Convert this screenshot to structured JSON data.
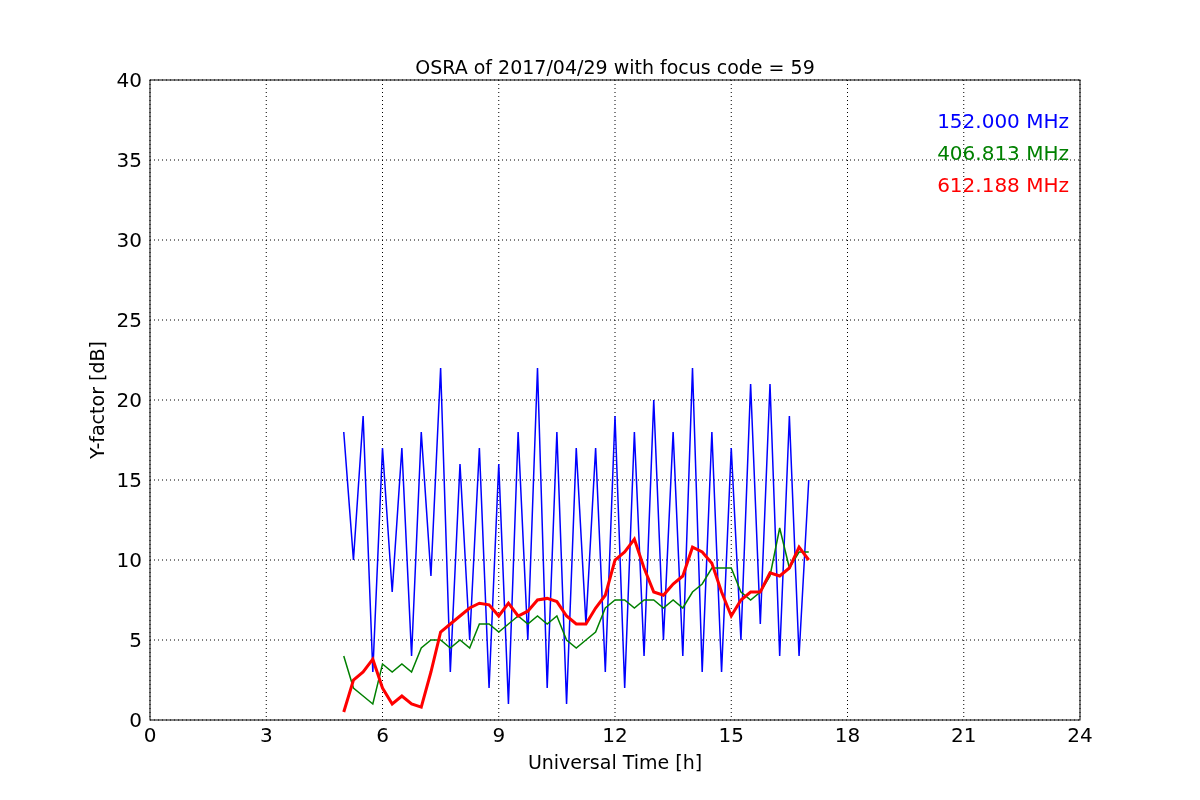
{
  "figure": {
    "chart_data": {
      "type": "line",
      "title": "OSRA of 2017/04/29 with focus code = 59",
      "xlabel": "Universal Time [h]",
      "ylabel": "Y-factor [dB]",
      "x": [
        5,
        5.25,
        5.5,
        5.75,
        6,
        6.25,
        6.5,
        6.75,
        7,
        7.25,
        7.5,
        7.75,
        8,
        8.25,
        8.5,
        8.75,
        9,
        9.25,
        9.5,
        9.75,
        10,
        10.25,
        10.5,
        10.75,
        11,
        11.25,
        11.5,
        11.75,
        12,
        12.25,
        12.5,
        12.75,
        13,
        13.25,
        13.5,
        13.75,
        14,
        14.25,
        14.5,
        14.75,
        15,
        15.25,
        15.5,
        15.75,
        16,
        16.25,
        16.5,
        16.75,
        17
      ],
      "series": [
        {
          "name": "152.000 MHz",
          "color": "#0000ff",
          "values": [
            18,
            10,
            19,
            3,
            17,
            8,
            17,
            4,
            18,
            9,
            22,
            3,
            16,
            5,
            17,
            2,
            16,
            1,
            18,
            5,
            22,
            2,
            18,
            1,
            17,
            6,
            17,
            3,
            19,
            2,
            18,
            4,
            20,
            5,
            18,
            4,
            22,
            3,
            18,
            3,
            17,
            5,
            21,
            6,
            21,
            4,
            19,
            4,
            15
          ]
        },
        {
          "name": "406.813 MHz",
          "color": "#008000",
          "values": [
            4,
            2,
            1.5,
            1,
            3.5,
            3,
            3.5,
            3,
            4.5,
            5,
            5,
            4.5,
            5,
            4.5,
            6,
            6,
            5.5,
            6,
            6.5,
            6,
            6.5,
            6,
            6.5,
            5,
            4.5,
            5,
            5.5,
            7,
            7.5,
            7.5,
            7,
            7.5,
            7.5,
            7,
            7.5,
            7,
            8,
            8.5,
            9.5,
            9.5,
            9.5,
            8,
            7.5,
            8,
            9,
            12,
            9.5,
            10.5,
            10.5
          ]
        },
        {
          "name": "612.188 MHz",
          "color": "#ff0000",
          "values": [
            0.5,
            2.5,
            3,
            3.8,
            2,
            1,
            1.5,
            1,
            0.8,
            3,
            5.5,
            6,
            6.5,
            7,
            7.3,
            7.2,
            6.5,
            7.3,
            6.5,
            6.8,
            7.5,
            7.6,
            7.4,
            6.5,
            6,
            6,
            7,
            7.8,
            10,
            10.5,
            11.3,
            9.5,
            8,
            7.8,
            8.5,
            9,
            10.8,
            10.5,
            9.8,
            8,
            6.5,
            7.5,
            8,
            8,
            9.2,
            9,
            9.5,
            10.8,
            10
          ]
        }
      ],
      "grid": true,
      "xlim": [
        0,
        24
      ],
      "ylim": [
        0,
        40
      ],
      "xticks": [
        0,
        3,
        6,
        9,
        12,
        15,
        18,
        21,
        24
      ],
      "yticks": [
        0,
        5,
        10,
        15,
        20,
        25,
        30,
        35,
        40
      ]
    }
  }
}
